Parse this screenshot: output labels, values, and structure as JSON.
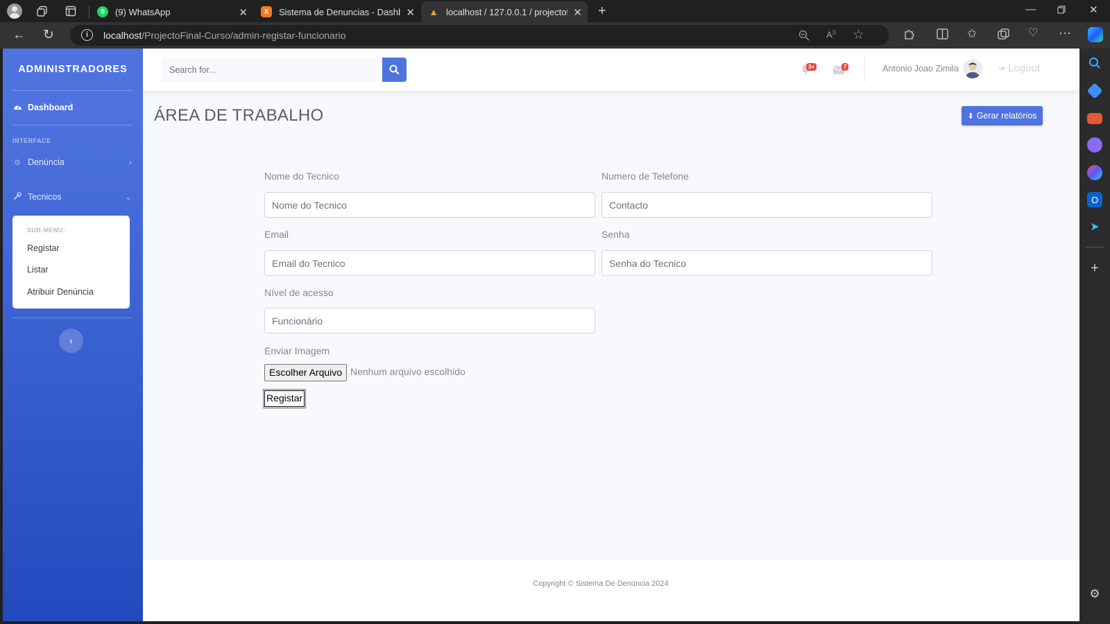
{
  "browser": {
    "tabs": [
      {
        "title": "(9) WhatsApp",
        "favicon_color": "#25d366",
        "favicon_glyph": "9"
      },
      {
        "title": "Sistema de Denuncias - Dashboard",
        "favicon_color": "#f47b20",
        "favicon_glyph": "X"
      },
      {
        "title": "localhost / 127.0.0.1 / projectofinal",
        "favicon_color": "#e8a23a",
        "favicon_glyph": "▲"
      }
    ],
    "url_host": "localhost",
    "url_path": "/ProjectoFinal-Curso/admin-registar-funcionario"
  },
  "sidebar": {
    "brand": "ADMINISTRADORES",
    "dashboard_label": "Dashboard",
    "interface_heading": "INTERFACE",
    "denuncia_label": "Denúncia",
    "tecnicos_label": "Tecnicos",
    "submenu_heading": "SUB-MENU:",
    "submenu_items": [
      "Registar",
      "Listar",
      "Atribuir Denúncia"
    ]
  },
  "topbar": {
    "search_placeholder": "Search for...",
    "alerts_badge": "3+",
    "messages_badge": "7",
    "user_name": "Antonio Joao Zimila",
    "logout_label": "Logout"
  },
  "page": {
    "title": "ÁREA DE TRABALHO",
    "report_button": "Gerar relatórios"
  },
  "form": {
    "nome_label": "Nome do Tecnico",
    "nome_placeholder": "Nome do Tecnico",
    "telefone_label": "Numero de Telefone",
    "telefone_placeholder": "Contacto",
    "email_label": "Email",
    "email_placeholder": "Email do Tecnico",
    "senha_label": "Senha",
    "senha_placeholder": "Senha do Tecnico",
    "nivel_label": "Nível de acesso",
    "nivel_value": "Funcionário",
    "imagem_label": "Enviar Imagem",
    "file_button": "Escolher Arquivo",
    "file_status": "Nenhum arquivo escolhido",
    "submit_label": "Registar"
  },
  "footer": {
    "copyright": "Copyright © Sistema De Denúncia 2024"
  },
  "colors": {
    "primary": "#4e73df",
    "danger": "#e74a3b",
    "text_gray": "#858796"
  }
}
